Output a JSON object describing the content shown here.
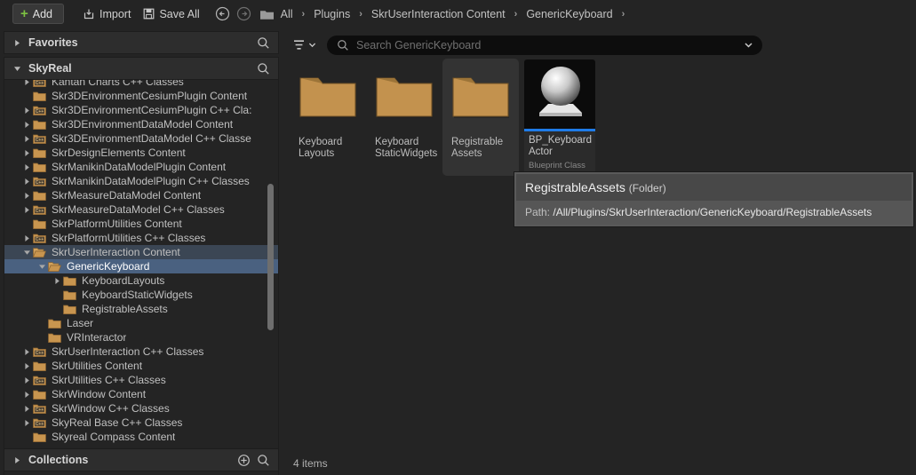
{
  "toolbar": {
    "add_label": "Add",
    "import_label": "Import",
    "save_all_label": "Save All",
    "root_label": "All"
  },
  "breadcrumb": {
    "separator": "›",
    "items": [
      {
        "label": "Plugins"
      },
      {
        "label": "SkrUserInteraction Content"
      },
      {
        "label": "GenericKeyboard"
      }
    ]
  },
  "sidebar": {
    "favorites": {
      "title": "Favorites",
      "expanded": false
    },
    "skyreal": {
      "title": "SkyReal",
      "expanded": true
    },
    "collections": {
      "title": "Collections"
    },
    "tree": [
      {
        "label": "Kantan Charts C++ Classes",
        "indent": 1,
        "icon": "cpp-folder-icon",
        "tri": "collapsed",
        "state": "normal"
      },
      {
        "label": "Skr3DEnvironmentCesiumPlugin Content",
        "indent": 1,
        "icon": "folder-icon",
        "tri": "none",
        "state": "normal"
      },
      {
        "label": "Skr3DEnvironmentCesiumPlugin C++ Cla:",
        "indent": 1,
        "icon": "cpp-folder-icon",
        "tri": "collapsed",
        "state": "normal"
      },
      {
        "label": "Skr3DEnvironmentDataModel Content",
        "indent": 1,
        "icon": "folder-icon",
        "tri": "collapsed",
        "state": "normal"
      },
      {
        "label": "Skr3DEnvironmentDataModel C++ Classe",
        "indent": 1,
        "icon": "cpp-folder-icon",
        "tri": "collapsed",
        "state": "normal"
      },
      {
        "label": "SkrDesignElements Content",
        "indent": 1,
        "icon": "folder-icon",
        "tri": "collapsed",
        "state": "normal"
      },
      {
        "label": "SkrManikinDataModelPlugin Content",
        "indent": 1,
        "icon": "folder-icon",
        "tri": "collapsed",
        "state": "normal"
      },
      {
        "label": "SkrManikinDataModelPlugin C++ Classes",
        "indent": 1,
        "icon": "cpp-folder-icon",
        "tri": "collapsed",
        "state": "normal"
      },
      {
        "label": "SkrMeasureDataModel Content",
        "indent": 1,
        "icon": "folder-icon",
        "tri": "collapsed",
        "state": "normal"
      },
      {
        "label": "SkrMeasureDataModel C++ Classes",
        "indent": 1,
        "icon": "cpp-folder-icon",
        "tri": "collapsed",
        "state": "normal"
      },
      {
        "label": "SkrPlatformUtilities Content",
        "indent": 1,
        "icon": "folder-icon",
        "tri": "none",
        "state": "normal"
      },
      {
        "label": "SkrPlatformUtilities C++ Classes",
        "indent": 1,
        "icon": "cpp-folder-icon",
        "tri": "collapsed",
        "state": "normal"
      },
      {
        "label": "SkrUserInteraction Content",
        "indent": 1,
        "icon": "folder-open-icon",
        "tri": "expanded",
        "state": "sel-soft"
      },
      {
        "label": "GenericKeyboard",
        "indent": 2,
        "icon": "folder-open-icon",
        "tri": "expanded",
        "state": "sel"
      },
      {
        "label": "KeyboardLayouts",
        "indent": 3,
        "icon": "folder-icon",
        "tri": "collapsed",
        "state": "normal"
      },
      {
        "label": "KeyboardStaticWidgets",
        "indent": 3,
        "icon": "folder-icon",
        "tri": "none",
        "state": "normal"
      },
      {
        "label": "RegistrableAssets",
        "indent": 3,
        "icon": "folder-icon",
        "tri": "none",
        "state": "normal"
      },
      {
        "label": "Laser",
        "indent": 2,
        "icon": "folder-icon",
        "tri": "none",
        "state": "normal"
      },
      {
        "label": "VRInteractor",
        "indent": 2,
        "icon": "folder-icon",
        "tri": "none",
        "state": "normal"
      },
      {
        "label": "SkrUserInteraction C++ Classes",
        "indent": 1,
        "icon": "cpp-folder-icon",
        "tri": "collapsed",
        "state": "normal"
      },
      {
        "label": "SkrUtilities Content",
        "indent": 1,
        "icon": "folder-icon",
        "tri": "collapsed",
        "state": "normal"
      },
      {
        "label": "SkrUtilities C++ Classes",
        "indent": 1,
        "icon": "cpp-folder-icon",
        "tri": "collapsed",
        "state": "normal"
      },
      {
        "label": "SkrWindow Content",
        "indent": 1,
        "icon": "folder-icon",
        "tri": "collapsed",
        "state": "normal"
      },
      {
        "label": "SkrWindow C++ Classes",
        "indent": 1,
        "icon": "cpp-folder-icon",
        "tri": "collapsed",
        "state": "normal"
      },
      {
        "label": "SkyReal Base C++ Classes",
        "indent": 1,
        "icon": "cpp-folder-icon",
        "tri": "collapsed",
        "state": "normal"
      },
      {
        "label": "Skyreal Compass Content",
        "indent": 1,
        "icon": "folder-icon",
        "tri": "none",
        "state": "normal"
      }
    ]
  },
  "search": {
    "placeholder": "Search GenericKeyboard"
  },
  "assets": {
    "folders": [
      {
        "line1": "Keyboard",
        "line2": "Layouts",
        "hover": false
      },
      {
        "line1": "Keyboard",
        "line2": "StaticWidgets",
        "hover": false
      },
      {
        "line1": "Registrable",
        "line2": "Assets",
        "hover": true
      }
    ],
    "blueprint": {
      "name_line1": "BP_Keyboard",
      "name_line2": "Actor",
      "type": "Blueprint Class",
      "accent_color": "#1f7ce8"
    }
  },
  "tooltip": {
    "title": "RegistrableAssets",
    "kind": "(Folder)",
    "path_key": "Path:",
    "path_value": "/All/Plugins/SkrUserInteraction/GenericKeyboard/RegistrableAssets"
  },
  "status": {
    "item_count": "4 items"
  }
}
